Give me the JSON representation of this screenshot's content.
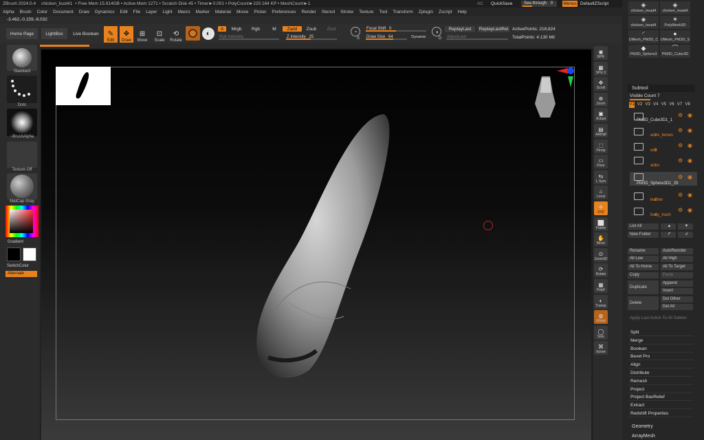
{
  "title_bar": {
    "app": "ZBrush 2024.0.4",
    "file": "chicken_bust41",
    "stats": "• Free Mem 15.914GB • Active Mem 1271 • Scratch Disk 45 • Timer►0.001 • PolyCount►220.164 KP • MeshCount►1",
    "ac": "AC",
    "quicksave": "QuickSave",
    "seethrough": "See-through",
    "seethrough_val": "0",
    "menus": "Menus",
    "script": "DefaultZScript"
  },
  "menu": [
    "Alpha",
    "Brush",
    "Color",
    "Document",
    "Draw",
    "Dynamics",
    "Edit",
    "File",
    "Layer",
    "Light",
    "Macro",
    "Marker",
    "Material",
    "Movie",
    "Picker",
    "Preferences",
    "Render",
    "Stencil",
    "Stroke",
    "Texture",
    "Tool",
    "Transform",
    "Zplugin",
    "Zscript",
    "Help"
  ],
  "coords": "-3.462,-0.159,-6.032",
  "toolbar": {
    "home": "Home Page",
    "lightbox": "LightBox",
    "live_boolean": "Live Boolean",
    "edit": "Edit",
    "draw": "Draw",
    "move": "Move",
    "scale": "Scale",
    "rotate": "Rotate",
    "a": "A",
    "mrgb": "Mrgb",
    "rgb": "Rgb",
    "m": "M",
    "zadd": "Zadd",
    "zsub": "Zsub",
    "zcut": "Zcut",
    "rgb_intensity": "Rgb Intensity",
    "z_intensity": "Z Intensity",
    "z_intensity_val": "25",
    "focal_shift": "Focal Shift",
    "focal_val": "0",
    "draw_size": "Draw Size",
    "draw_size_val": "64",
    "dynamic": "Dynamic",
    "replay_last": "ReplayLast",
    "replay_last_rel": "ReplayLastRel",
    "adjust_last": "AdjustLast",
    "active_points": "ActivePoints: 218,824",
    "total_points": "TotalPoints: 4.130 Mil",
    "s": "S",
    "d": "D"
  },
  "left_shelf": {
    "standard": "Standard",
    "dots": "Dots",
    "brush_alpha": "~BrushAlpha",
    "texture_off": "Texture Off",
    "matcap": "MatCap Gray",
    "gradient": "Gradient",
    "switch_color": "SwitchColor",
    "alternate": "Alternate"
  },
  "right_shelf": [
    {
      "label": "BPR",
      "icon": "◉"
    },
    {
      "label": "SPix 3",
      "icon": "▦"
    },
    {
      "label": "Scroll",
      "icon": "✥"
    },
    {
      "label": "Zoom",
      "icon": "⊕"
    },
    {
      "label": "Actual",
      "icon": "▣"
    },
    {
      "label": "AAHalf",
      "icon": "▤"
    },
    {
      "label": "Persp",
      "icon": "⬚"
    },
    {
      "label": "Floor",
      "icon": "▭"
    },
    {
      "label": "L.Sym",
      "icon": "⇆"
    },
    {
      "label": "Local",
      "icon": "⌂"
    },
    {
      "label": "XYZ",
      "icon": "✛"
    },
    {
      "label": "Frame",
      "icon": "⬜"
    },
    {
      "label": "Move",
      "icon": "✋"
    },
    {
      "label": "Zoom3D",
      "icon": "⊙"
    },
    {
      "label": "Rotate",
      "icon": "⟳"
    },
    {
      "label": "PolyF",
      "icon": "▦"
    },
    {
      "label": "Transp",
      "icon": "◐"
    },
    {
      "label": "Ghost",
      "icon": "◍"
    },
    {
      "label": "Solo",
      "icon": "◯"
    },
    {
      "label": "Xpose",
      "icon": "⌘"
    }
  ],
  "tools": [
    {
      "name": "chicken_head4",
      "icon": "◈"
    },
    {
      "name": "chicken_head4",
      "icon": "◈"
    },
    {
      "name": "chicken_head4",
      "icon": "◈"
    },
    {
      "name": "PolyMesh3D",
      "icon": "✶"
    },
    {
      "name": "UMesh_PM3D_C",
      "icon": "◜"
    },
    {
      "name": "UMesh_PM3D_S",
      "icon": "●"
    },
    {
      "name": "PM3D_Sphere3",
      "icon": "◆"
    },
    {
      "name": "PM3D_Cube3D",
      "icon": "⌒"
    }
  ],
  "subtool": {
    "header": "Subtool",
    "visible_count": "Visible Count 7",
    "v_tabs": [
      "V1",
      "V2",
      "V3",
      "V4",
      "V5",
      "V6",
      "V7",
      "V8"
    ],
    "items": [
      {
        "name": "PM3D_Cube3D1_1"
      },
      {
        "name": "arms_bones",
        "num": "2"
      },
      {
        "name": "edit",
        "num": "3"
      },
      {
        "name": "arms",
        "num": "1"
      },
      {
        "name": "PM3D_Sphere3D1_29"
      },
      {
        "name": "leather",
        "num": "5"
      },
      {
        "name": "body_trash",
        "num": "6"
      }
    ],
    "list_all": "List All",
    "new_folder": "New Folder",
    "rename": "Rename",
    "auto_reorder": "AutoReorder",
    "all_low": "All Low",
    "all_high": "All High",
    "all_to_home": "All To Home",
    "all_to_target": "All To Target",
    "copy": "Copy",
    "paste": "Paste",
    "duplicate": "Duplicate",
    "append": "Append",
    "insert": "Insert",
    "delete": "Delete",
    "del_other": "Del Other",
    "del_all": "Del All",
    "apply_last": "Apply Last Action To All Subtoo"
  },
  "sections": [
    "Split",
    "Merge",
    "Boolean",
    "Bevel Pro",
    "Align",
    "Distribute",
    "Remesh",
    "Project",
    "Project BasRelief",
    "Extract",
    "Redshift Properties"
  ],
  "geometry": "Geometry",
  "arraymesh": "ArrayMesh"
}
